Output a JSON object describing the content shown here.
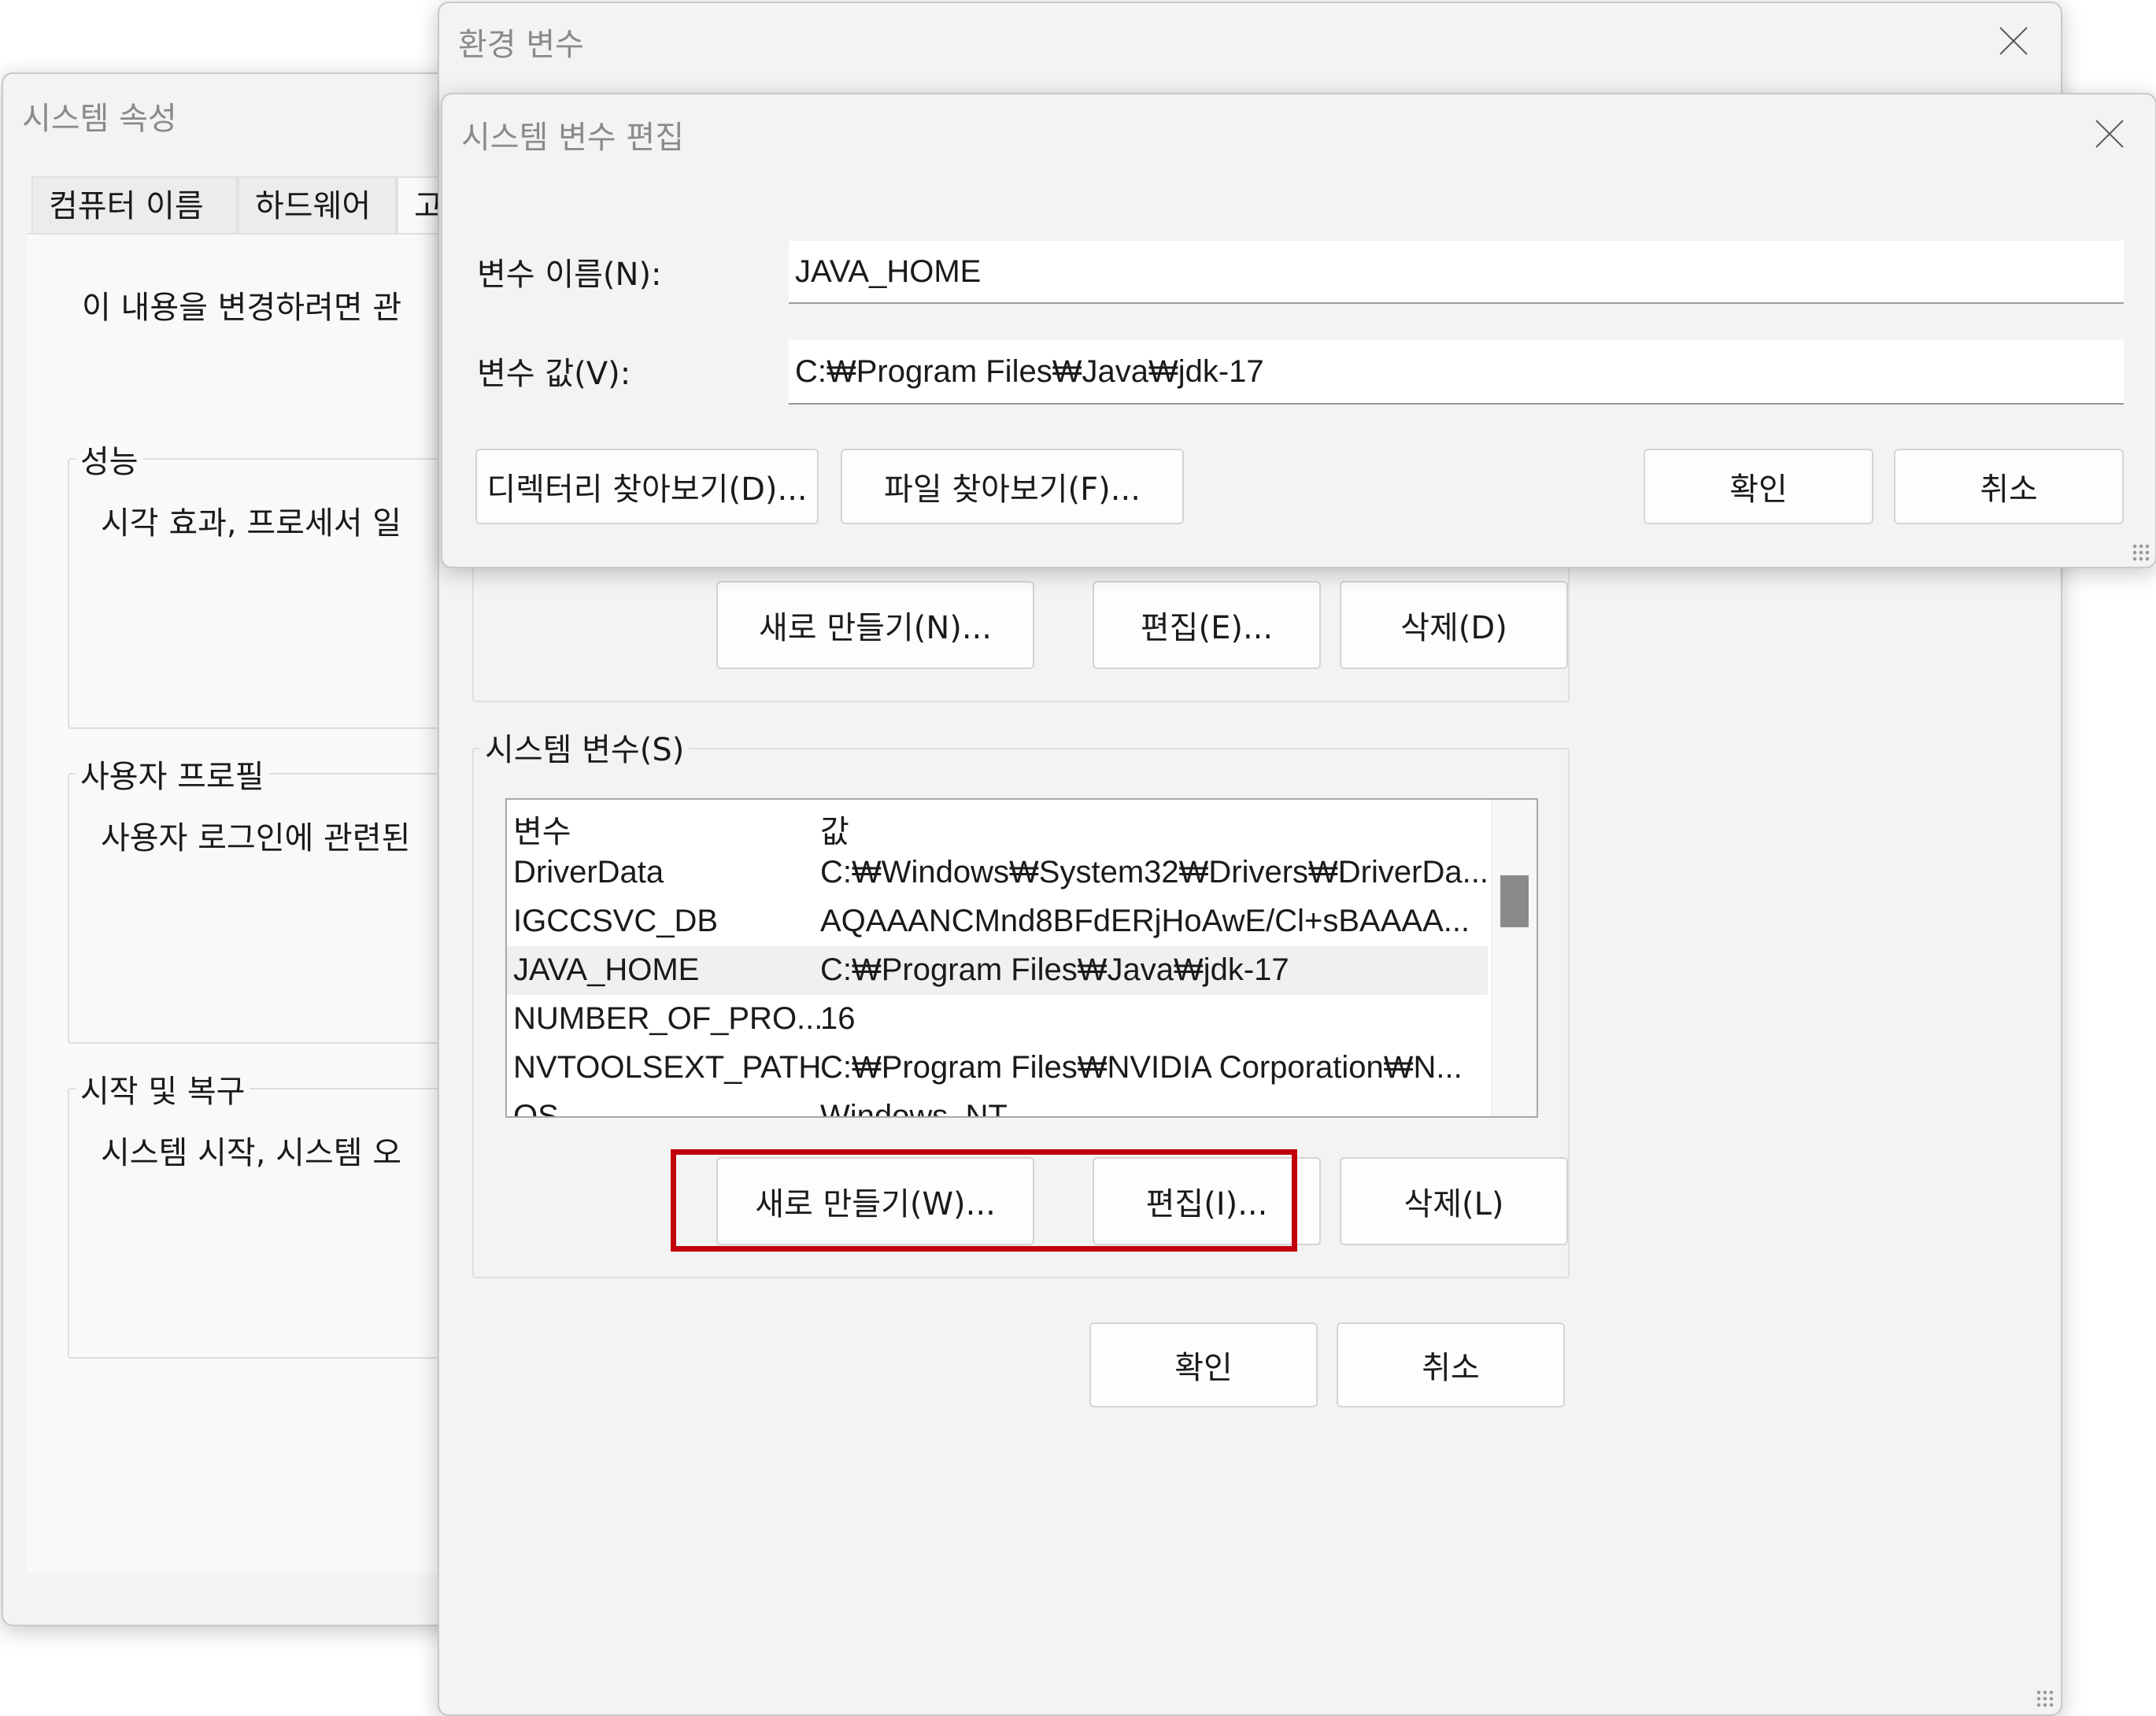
{
  "system_properties": {
    "title": "시스템 속성",
    "tabs": [
      "컴퓨터 이름",
      "하드웨어",
      "고"
    ],
    "admin_note": "이 내용을 변경하려면 관",
    "groups": [
      {
        "legend": "성능",
        "text": "시각 효과, 프로세서 일"
      },
      {
        "legend": "사용자 프로필",
        "text": "사용자 로그인에 관련된"
      },
      {
        "legend": "시작 및 복구",
        "text": "시스템 시작, 시스템 오"
      }
    ]
  },
  "environment_variables": {
    "title": "환경 변수",
    "user_buttons": {
      "new": "새로 만들기(N)...",
      "edit": "편집(E)...",
      "delete": "삭제(D)"
    },
    "system_section_label": "시스템 변수(S)",
    "table": {
      "headers": [
        "변수",
        "값"
      ],
      "rows": [
        {
          "name": "DriverData",
          "value": "C:₩Windows₩System32₩Drivers₩DriverDa..."
        },
        {
          "name": "IGCCSVC_DB",
          "value": "AQAAANCMnd8BFdERjHoAwE/Cl+sBAAAA..."
        },
        {
          "name": "JAVA_HOME",
          "value": "C:₩Program Files₩Java₩jdk-17",
          "selected": true
        },
        {
          "name": "NUMBER_OF_PRO...",
          "value": "16"
        },
        {
          "name": "NVTOOLSEXT_PATH",
          "value": "C:₩Program Files₩NVIDIA Corporation₩N..."
        },
        {
          "name": "OS",
          "value": "Windows_NT"
        }
      ]
    },
    "system_buttons": {
      "new": "새로 만들기(W)...",
      "edit": "편집(I)...",
      "delete": "삭제(L)"
    },
    "ok": "확인",
    "cancel": "취소",
    "highlight_color": "#c1000b"
  },
  "edit_dialog": {
    "title": "시스템 변수 편집",
    "name_label": "변수 이름(N):",
    "name_value": "JAVA_HOME",
    "value_label": "변수 값(V):",
    "value_value": "C:₩Program Files₩Java₩jdk-17",
    "browse_dir": "디렉터리 찾아보기(D)...",
    "browse_file": "파일 찾아보기(F)...",
    "ok": "확인",
    "cancel": "취소"
  }
}
